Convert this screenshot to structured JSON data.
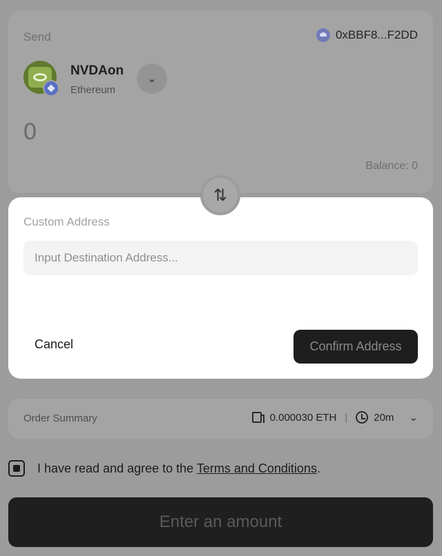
{
  "send": {
    "label": "Send",
    "wallet_address": "0xBBF8...F2DD",
    "token_symbol": "NVDAon",
    "token_chain": "Ethereum",
    "amount": "0",
    "balance": "Balance: 0"
  },
  "modal": {
    "title": "Custom Address",
    "input_placeholder": "Input Destination Address...",
    "input_value": "",
    "cancel_label": "Cancel",
    "confirm_label": "Confirm Address"
  },
  "summary": {
    "label": "Order Summary",
    "gas": "0.000030 ETH",
    "separator": "|",
    "time": "20m"
  },
  "terms": {
    "text_before": "I have read and agree to the ",
    "link": "Terms and Conditions",
    "text_after": "."
  },
  "action": {
    "label": "Enter an amount"
  },
  "colors": {
    "overlay_bg": "#9c9c9c",
    "modal_bg": "#ffffff",
    "dark_button": "#1e1e1e",
    "chain_blue": "#5a6fc2"
  },
  "icons": {
    "wallet": "wallet-avatar-icon",
    "chain": "ethereum-icon",
    "swap": "swap-arrows-icon",
    "gas": "gas-pump-icon",
    "time": "clock-icon",
    "dropdown": "chevron-down-icon"
  }
}
